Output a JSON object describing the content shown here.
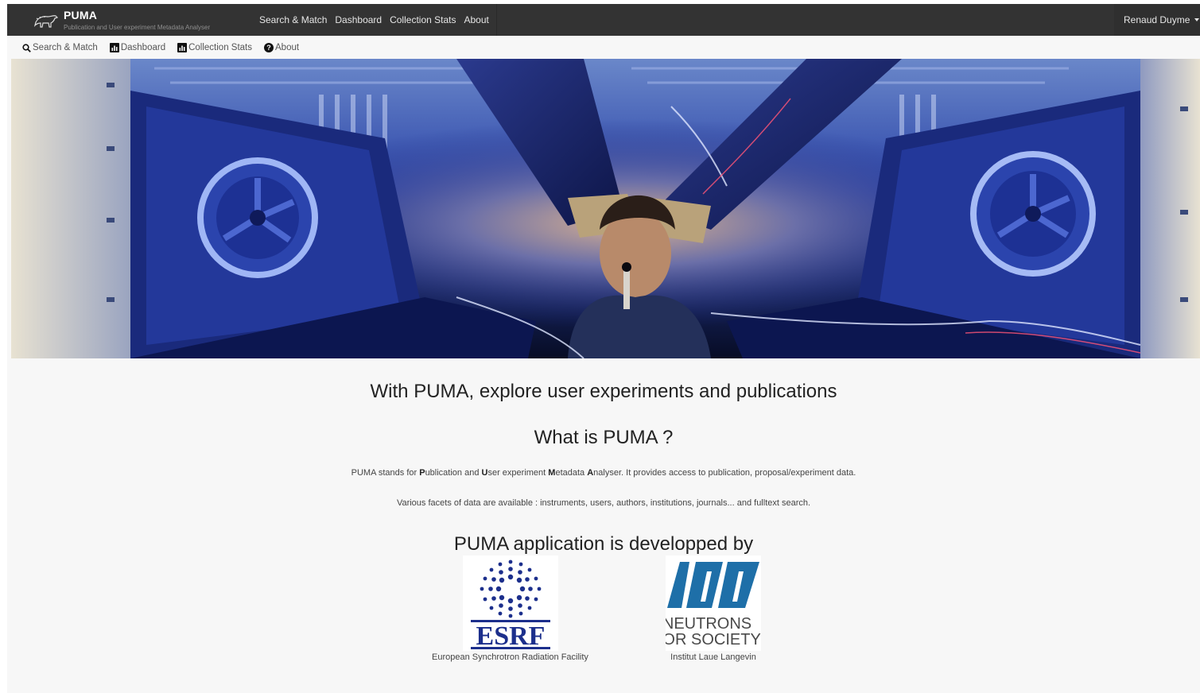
{
  "app": {
    "title": "PUMA",
    "subtitle": "Publication and User experiment Metadata Analyser"
  },
  "topnav": {
    "items": [
      {
        "label": "Search & Match"
      },
      {
        "label": "Dashboard"
      },
      {
        "label": "Collection Stats"
      },
      {
        "label": "About"
      }
    ],
    "user": "Renaud Duyme"
  },
  "subnav": {
    "items": [
      {
        "label": "Search & Match",
        "icon": "search-icon"
      },
      {
        "label": "Dashboard",
        "icon": "bar-chart-icon"
      },
      {
        "label": "Collection Stats",
        "icon": "bar-chart-icon"
      },
      {
        "label": "About",
        "icon": "question-circle-icon"
      }
    ]
  },
  "main": {
    "headline": "With PUMA, explore user experiments and publications",
    "what_title": "What is PUMA ?",
    "desc": {
      "pre": "PUMA stands for ",
      "p": "P",
      "p_rest": "ublication and ",
      "u": "U",
      "u_rest": "ser experiment ",
      "m": "M",
      "m_rest": "etadata ",
      "a": "A",
      "a_rest": "nalyser. It provides access to publication, proposal/experiment data."
    },
    "facets": "Various facets of data are available : instruments, users, authors, institutions, journals... and fulltext search.",
    "developed_by": "PUMA application is developped by"
  },
  "partners": [
    {
      "name": "European Synchrotron Radiation Facility",
      "logo_text": "ESRF",
      "color": "#1c2f8c"
    },
    {
      "name": "Institut Laue Langevin",
      "logo_text_1": "NEUTRONS",
      "logo_text_2": "FOR SOCIETY",
      "color": "#1e6fa8"
    }
  ],
  "colors": {
    "navbar": "#333333",
    "hero_tone": "#1b3a9a"
  }
}
